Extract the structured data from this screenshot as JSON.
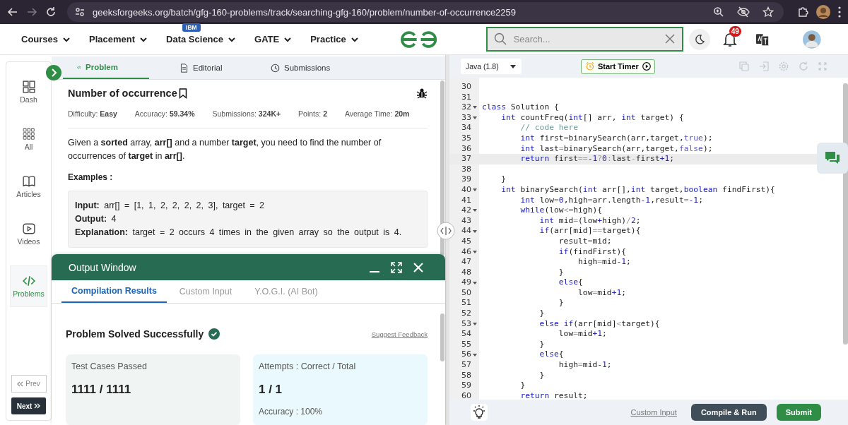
{
  "browser": {
    "buttons": [
      {
        "kind": "back",
        "disabled": false
      },
      {
        "kind": "forward",
        "disabled": true
      },
      {
        "kind": "reload",
        "disabled": false
      }
    ],
    "url": "geeksforgeeks.org/batch/gfg-160-problems/track/searching-gfg-160/problem/number-of-occurrence2259"
  },
  "nav": {
    "items": [
      {
        "label": "Courses"
      },
      {
        "label": "Placement"
      },
      {
        "label": "Data Science",
        "badge": "IBM"
      },
      {
        "label": "GATE"
      },
      {
        "label": "Practice"
      }
    ],
    "search": {
      "placeholder": "Search..."
    },
    "notifications": "49"
  },
  "sidebar": {
    "items": [
      {
        "label": "Dash",
        "kind": "dash",
        "selected": false
      },
      {
        "label": "All",
        "kind": "all",
        "selected": false
      },
      {
        "label": "Articles",
        "kind": "articles",
        "selected": false
      },
      {
        "label": "Videos",
        "kind": "videos",
        "selected": false
      },
      {
        "label": "Problems",
        "kind": "problems",
        "selected": true
      }
    ],
    "prev": "Prev",
    "next": "Next"
  },
  "problem": {
    "tabs": [
      {
        "label": "Problem",
        "kind": "code",
        "selected": true
      },
      {
        "label": "Editorial",
        "kind": "doc",
        "selected": false
      },
      {
        "label": "Submissions",
        "kind": "clock",
        "selected": false
      }
    ],
    "title": "Number of occurrence",
    "meta": [
      "Difficulty: **Easy**",
      "Accuracy: **59.34%**",
      "Submissions: **324K+**",
      "Points: **2**",
      "Average Time: **20m**"
    ],
    "description": "Given a **sorted** array, **arr[]** and a number **target**, you need to find the number of occurrences of **target** in **arr[]**.",
    "examples_heading": "Examples :",
    "example": [
      "**Input:** arr[] = [1, 1, 2, 2, 2, 2, 3], target = 2",
      "**Output:** 4",
      "**Explanation:** target = 2 occurs 4 times in the given array so the output is 4."
    ]
  },
  "output_window": {
    "title": "Output Window",
    "tabs": [
      {
        "label": "Compilation Results",
        "selected": true
      },
      {
        "label": "Custom Input",
        "selected": false
      },
      {
        "label": "Y.O.G.I. (AI Bot)",
        "selected": false
      }
    ],
    "status": "Problem Solved Successfully",
    "feedback": "Suggest Feedback",
    "cards": [
      {
        "label": "Test Cases Passed",
        "value": "1111 / 1111",
        "color": "#f0f5f4"
      },
      {
        "label": "Attempts : Correct / Total",
        "value": "1 / 1",
        "extra": "Accuracy : 100%",
        "color": "#eaf9fd"
      }
    ]
  },
  "editor": {
    "language": "Java (1.8)",
    "timer": "Start Timer",
    "lines": [
      {
        "n": "30",
        "fold": false,
        "active": false
      },
      {
        "n": "31",
        "fold": false,
        "active": false
      },
      {
        "n": "32",
        "fold": true,
        "active": false,
        "spans": [
          {
            "kind": "k",
            "text": "class"
          },
          {
            "kind": "t",
            "text": " Solution {"
          }
        ]
      },
      {
        "n": "33",
        "fold": true,
        "active": false,
        "spans": [
          {
            "kind": "k",
            "text": "    int"
          },
          {
            "kind": "t",
            "text": " countFreq("
          },
          {
            "kind": "k",
            "text": "int"
          },
          {
            "kind": "t",
            "text": "[] arr, "
          },
          {
            "kind": "k",
            "text": "int"
          },
          {
            "kind": "t",
            "text": " target) {"
          }
        ]
      },
      {
        "n": "34",
        "fold": false,
        "active": false,
        "spans": [
          {
            "kind": "c",
            "text": "        // code here"
          }
        ]
      },
      {
        "n": "35",
        "fold": false,
        "active": false,
        "spans": [
          {
            "kind": "k",
            "text": "        int"
          },
          {
            "kind": "t",
            "text": " first"
          },
          {
            "kind": "o",
            "text": "="
          },
          {
            "kind": "t",
            "text": "binarySearch(arr,target,"
          },
          {
            "kind": "l",
            "text": "true"
          },
          {
            "kind": "t",
            "text": ");"
          }
        ]
      },
      {
        "n": "36",
        "fold": false,
        "active": false,
        "spans": [
          {
            "kind": "k",
            "text": "        int"
          },
          {
            "kind": "t",
            "text": " last"
          },
          {
            "kind": "o",
            "text": "="
          },
          {
            "kind": "t",
            "text": "binarySearch(arr,target,"
          },
          {
            "kind": "l",
            "text": "false"
          },
          {
            "kind": "t",
            "text": ");"
          }
        ]
      },
      {
        "n": "37",
        "fold": false,
        "active": true,
        "spans": [
          {
            "kind": "k",
            "text": "        return"
          },
          {
            "kind": "t",
            "text": " first"
          },
          {
            "kind": "o",
            "text": "=="
          },
          {
            "kind": "n",
            "text": "-1"
          },
          {
            "kind": "o",
            "text": "?"
          },
          {
            "kind": "n",
            "text": "0"
          },
          {
            "kind": "o",
            "text": ":"
          },
          {
            "kind": "t",
            "text": "last"
          },
          {
            "kind": "o",
            "text": "-"
          },
          {
            "kind": "t",
            "text": "first"
          },
          {
            "kind": "n",
            "text": "+1"
          },
          {
            "kind": "t",
            "text": ";"
          }
        ]
      },
      {
        "n": "38",
        "fold": false,
        "active": false
      },
      {
        "n": "39",
        "fold": false,
        "active": false,
        "spans": [
          {
            "kind": "t",
            "text": "    }"
          }
        ]
      },
      {
        "n": "40",
        "fold": true,
        "active": false,
        "spans": [
          {
            "kind": "k",
            "text": "    int"
          },
          {
            "kind": "t",
            "text": " binarySearch("
          },
          {
            "kind": "k",
            "text": "int"
          },
          {
            "kind": "t",
            "text": " arr[],"
          },
          {
            "kind": "k",
            "text": "int"
          },
          {
            "kind": "t",
            "text": " target,"
          },
          {
            "kind": "k",
            "text": "boolean"
          },
          {
            "kind": "t",
            "text": " findFirst){"
          }
        ]
      },
      {
        "n": "41",
        "fold": false,
        "active": false,
        "spans": [
          {
            "kind": "k",
            "text": "        int"
          },
          {
            "kind": "t",
            "text": " low"
          },
          {
            "kind": "o",
            "text": "="
          },
          {
            "kind": "n",
            "text": "0"
          },
          {
            "kind": "t",
            "text": ",high"
          },
          {
            "kind": "o",
            "text": "="
          },
          {
            "kind": "t",
            "text": "arr.length"
          },
          {
            "kind": "n",
            "text": "-1"
          },
          {
            "kind": "t",
            "text": ",result"
          },
          {
            "kind": "o",
            "text": "="
          },
          {
            "kind": "n",
            "text": "-1"
          },
          {
            "kind": "t",
            "text": ";"
          }
        ]
      },
      {
        "n": "42",
        "fold": true,
        "active": false,
        "spans": [
          {
            "kind": "k",
            "text": "        while"
          },
          {
            "kind": "t",
            "text": "(low"
          },
          {
            "kind": "o",
            "text": "<="
          },
          {
            "kind": "t",
            "text": "high){"
          }
        ]
      },
      {
        "n": "43",
        "fold": false,
        "active": false,
        "spans": [
          {
            "kind": "k",
            "text": "            int"
          },
          {
            "kind": "t",
            "text": " mid"
          },
          {
            "kind": "o",
            "text": "="
          },
          {
            "kind": "t",
            "text": "(low"
          },
          {
            "kind": "n",
            "text": "+"
          },
          {
            "kind": "t",
            "text": "high)"
          },
          {
            "kind": "o",
            "text": "/"
          },
          {
            "kind": "n",
            "text": "2"
          },
          {
            "kind": "t",
            "text": ";"
          }
        ]
      },
      {
        "n": "44",
        "fold": true,
        "active": false,
        "spans": [
          {
            "kind": "k",
            "text": "            if"
          },
          {
            "kind": "t",
            "text": "(arr[mid]"
          },
          {
            "kind": "o",
            "text": "=="
          },
          {
            "kind": "t",
            "text": "target){"
          }
        ]
      },
      {
        "n": "45",
        "fold": false,
        "active": false,
        "spans": [
          {
            "kind": "t",
            "text": "                result"
          },
          {
            "kind": "o",
            "text": "="
          },
          {
            "kind": "t",
            "text": "mid;"
          }
        ]
      },
      {
        "n": "46",
        "fold": true,
        "active": false,
        "spans": [
          {
            "kind": "k",
            "text": "                if"
          },
          {
            "kind": "t",
            "text": "(findFirst){"
          }
        ]
      },
      {
        "n": "47",
        "fold": false,
        "active": false,
        "spans": [
          {
            "kind": "t",
            "text": "                    high"
          },
          {
            "kind": "o",
            "text": "="
          },
          {
            "kind": "t",
            "text": "mid"
          },
          {
            "kind": "n",
            "text": "-1"
          },
          {
            "kind": "t",
            "text": ";"
          }
        ]
      },
      {
        "n": "48",
        "fold": false,
        "active": false,
        "spans": [
          {
            "kind": "t",
            "text": "                }"
          }
        ]
      },
      {
        "n": "49",
        "fold": true,
        "active": false,
        "spans": [
          {
            "kind": "k",
            "text": "                else"
          },
          {
            "kind": "t",
            "text": "{"
          }
        ]
      },
      {
        "n": "50",
        "fold": false,
        "active": false,
        "spans": [
          {
            "kind": "t",
            "text": "                    low"
          },
          {
            "kind": "o",
            "text": "="
          },
          {
            "kind": "t",
            "text": "mid"
          },
          {
            "kind": "n",
            "text": "+1"
          },
          {
            "kind": "t",
            "text": ";"
          }
        ]
      },
      {
        "n": "51",
        "fold": false,
        "active": false,
        "spans": [
          {
            "kind": "t",
            "text": "                }"
          }
        ]
      },
      {
        "n": "52",
        "fold": false,
        "active": false,
        "spans": [
          {
            "kind": "t",
            "text": "            }"
          }
        ]
      },
      {
        "n": "53",
        "fold": true,
        "active": false,
        "spans": [
          {
            "kind": "k",
            "text": "            else"
          },
          {
            "kind": "k",
            "text": " if"
          },
          {
            "kind": "t",
            "text": "(arr[mid]"
          },
          {
            "kind": "o",
            "text": "<"
          },
          {
            "kind": "t",
            "text": "target){"
          }
        ]
      },
      {
        "n": "54",
        "fold": false,
        "active": false,
        "spans": [
          {
            "kind": "t",
            "text": "                low"
          },
          {
            "kind": "o",
            "text": "="
          },
          {
            "kind": "t",
            "text": "mid"
          },
          {
            "kind": "n",
            "text": "+1"
          },
          {
            "kind": "t",
            "text": ";"
          }
        ]
      },
      {
        "n": "55",
        "fold": false,
        "active": false,
        "spans": [
          {
            "kind": "t",
            "text": "            }"
          }
        ]
      },
      {
        "n": "56",
        "fold": true,
        "active": false,
        "spans": [
          {
            "kind": "k",
            "text": "            else"
          },
          {
            "kind": "t",
            "text": "{"
          }
        ]
      },
      {
        "n": "57",
        "fold": false,
        "active": false,
        "spans": [
          {
            "kind": "t",
            "text": "                high"
          },
          {
            "kind": "o",
            "text": "="
          },
          {
            "kind": "t",
            "text": "mid"
          },
          {
            "kind": "n",
            "text": "-1"
          },
          {
            "kind": "t",
            "text": ";"
          }
        ]
      },
      {
        "n": "58",
        "fold": false,
        "active": false,
        "spans": [
          {
            "kind": "t",
            "text": "            }"
          }
        ]
      },
      {
        "n": "59",
        "fold": false,
        "active": false,
        "spans": [
          {
            "kind": "t",
            "text": "        }"
          }
        ]
      },
      {
        "n": "60",
        "fold": false,
        "active": false,
        "spans": [
          {
            "kind": "k",
            "text": "        return"
          },
          {
            "kind": "t",
            "text": " result;"
          }
        ]
      }
    ],
    "custom_input": "Custom Input",
    "run": "Compile & Run",
    "submit": "Submit"
  }
}
